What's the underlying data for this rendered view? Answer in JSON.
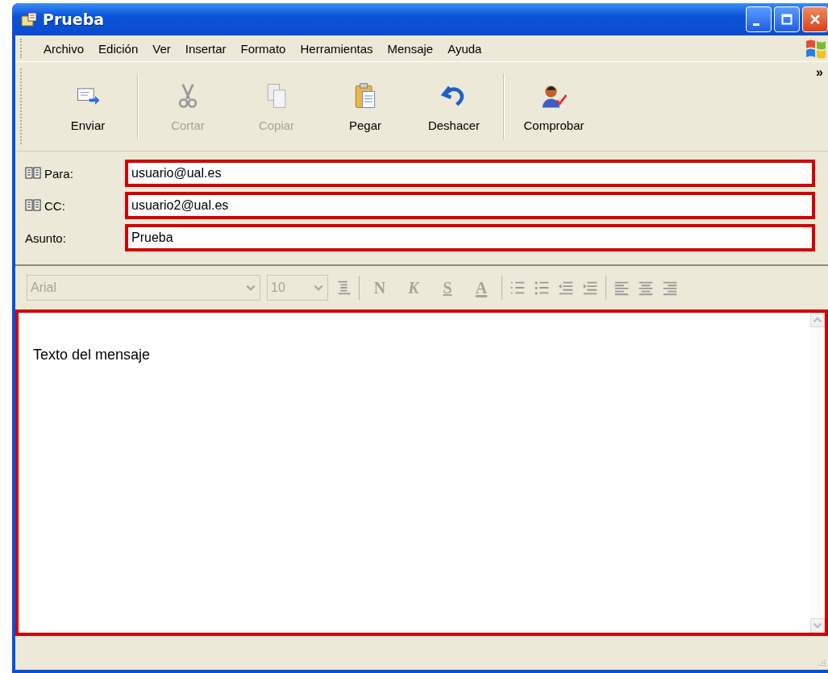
{
  "window": {
    "title": "Prueba"
  },
  "menu": [
    {
      "label": "Archivo"
    },
    {
      "label": "Edición"
    },
    {
      "label": "Ver"
    },
    {
      "label": "Insertar"
    },
    {
      "label": "Formato"
    },
    {
      "label": "Herramientas"
    },
    {
      "label": "Mensaje"
    },
    {
      "label": "Ayuda"
    }
  ],
  "toolbar": [
    {
      "label": "Enviar",
      "kind": "send",
      "disabled": false,
      "separator_after": true
    },
    {
      "label": "Cortar",
      "kind": "cut",
      "disabled": true,
      "separator_after": false
    },
    {
      "label": "Copiar",
      "kind": "copy",
      "disabled": true,
      "separator_after": false
    },
    {
      "label": "Pegar",
      "kind": "paste",
      "disabled": false,
      "separator_after": false
    },
    {
      "label": "Deshacer",
      "kind": "undo",
      "disabled": false,
      "separator_after": true
    },
    {
      "label": "Comprobar",
      "kind": "check",
      "disabled": false,
      "separator_after": false
    }
  ],
  "toolbar_overflow": "»",
  "fields": [
    {
      "label": "Para:",
      "value": "usuario@ual.es",
      "kind": "address",
      "highlighted": true
    },
    {
      "label": "CC:",
      "value": "usuario2@ual.es",
      "kind": "address",
      "highlighted": true
    },
    {
      "label": "Asunto:",
      "value": "Prueba",
      "kind": "text",
      "highlighted": true
    }
  ],
  "format_bar": {
    "disabled": true,
    "font": "Arial",
    "size": "10",
    "buttons": [
      {
        "label": "N",
        "kind": "bold"
      },
      {
        "label": "K",
        "kind": "italic"
      },
      {
        "label": "S",
        "kind": "underline"
      },
      {
        "label": "A",
        "kind": "color"
      }
    ]
  },
  "body": {
    "text": "Texto del mensaje",
    "highlighted": true
  }
}
